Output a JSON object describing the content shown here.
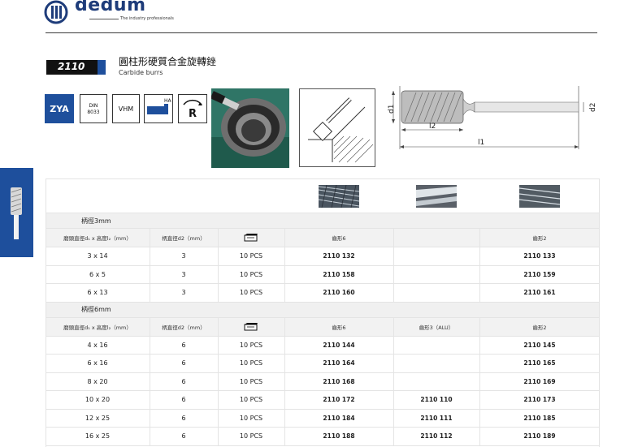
{
  "brand": {
    "name": "dedum",
    "tagline": "The industry professionals"
  },
  "product": {
    "code": "2110",
    "title_cn": "圓柱形硬質合金旋轉銼",
    "title_en": "Carbide burrs"
  },
  "badges": {
    "zya": "ZYA",
    "din_line1": "DIN",
    "din_line2": "8033",
    "vhm": "VHM",
    "ha": "HA",
    "r": "R"
  },
  "drawing_labels": {
    "d1": "d1",
    "d2": "d2",
    "l2": "l2",
    "l1": "l1"
  },
  "colors": {
    "brand_blue": "#1e4f9c",
    "logo_blue": "#1e3c7a",
    "code_bar": "#111111"
  },
  "table": {
    "thumb_icons": [
      "cut-6-icon",
      "cut-3-alu-icon",
      "cut-2-icon"
    ],
    "groups": [
      {
        "label": "柄徑3mm",
        "headers": {
          "dims": "磨頭直徑d₁ x 高度l₂（mm）",
          "shank": "柄直徑d2（mm）",
          "pack_icon": "package-icon",
          "cut6": "齒形6",
          "cut3": "",
          "cut2": "齒形2"
        },
        "rows": [
          {
            "dims": "3 x 14",
            "shank": "3",
            "pack": "10 PCS",
            "cut6": "2110 132",
            "cut3": "",
            "cut2": "2110 133"
          },
          {
            "dims": "6 x 5",
            "shank": "3",
            "pack": "10 PCS",
            "cut6": "2110 158",
            "cut3": "",
            "cut2": "2110 159"
          },
          {
            "dims": "6 x 13",
            "shank": "3",
            "pack": "10 PCS",
            "cut6": "2110 160",
            "cut3": "",
            "cut2": "2110 161"
          }
        ]
      },
      {
        "label": "柄徑6mm",
        "headers": {
          "dims": "磨頭直徑d₁ x 高度l₂（mm）",
          "shank": "柄直徑d2（mm）",
          "pack_icon": "package-icon",
          "cut6": "齒形6",
          "cut3": "齒形3（ALU）",
          "cut2": "齒形2"
        },
        "rows": [
          {
            "dims": "4 x 16",
            "shank": "6",
            "pack": "10 PCS",
            "cut6": "2110 144",
            "cut3": "",
            "cut2": "2110 145"
          },
          {
            "dims": "6 x 16",
            "shank": "6",
            "pack": "10 PCS",
            "cut6": "2110 164",
            "cut3": "",
            "cut2": "2110 165"
          },
          {
            "dims": "8 x 20",
            "shank": "6",
            "pack": "10 PCS",
            "cut6": "2110 168",
            "cut3": "",
            "cut2": "2110 169"
          },
          {
            "dims": "10 x 20",
            "shank": "6",
            "pack": "10 PCS",
            "cut6": "2110 172",
            "cut3": "2110 110",
            "cut2": "2110 173"
          },
          {
            "dims": "12 x 25",
            "shank": "6",
            "pack": "10 PCS",
            "cut6": "2110 184",
            "cut3": "2110 111",
            "cut2": "2110 185"
          },
          {
            "dims": "16 x 25",
            "shank": "6",
            "pack": "10 PCS",
            "cut6": "2110 188",
            "cut3": "2110 112",
            "cut2": "2110 189"
          }
        ]
      }
    ]
  }
}
